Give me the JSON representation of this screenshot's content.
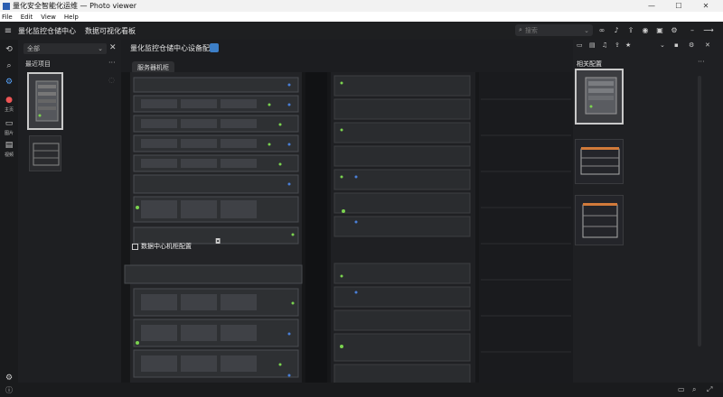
{
  "window": {
    "title": "量化安全智能化运维 — Photo viewer",
    "controls": [
      "—",
      "☐",
      "✕"
    ]
  },
  "menu": [
    "File",
    "Edit",
    "View",
    "Help"
  ],
  "appbar": {
    "title": "量化监控仓储中心",
    "subtitle": "数据可视化看板",
    "search_placeholder": "搜索"
  },
  "rail": {
    "items": [
      "主页",
      "图片",
      "视频",
      "设置"
    ]
  },
  "left_panel": {
    "filter": "全部",
    "title": "最近项目"
  },
  "center": {
    "doc_title": "量化监控仓储中心设备配置",
    "pill": "服务器机柜",
    "caption": "数据中心机柜配置"
  },
  "right_panel": {
    "title": "相关配置"
  },
  "colors": {
    "accent": "#3d7fc7",
    "led_green": "#7bd34f",
    "led_blue": "#4a7fd8"
  }
}
